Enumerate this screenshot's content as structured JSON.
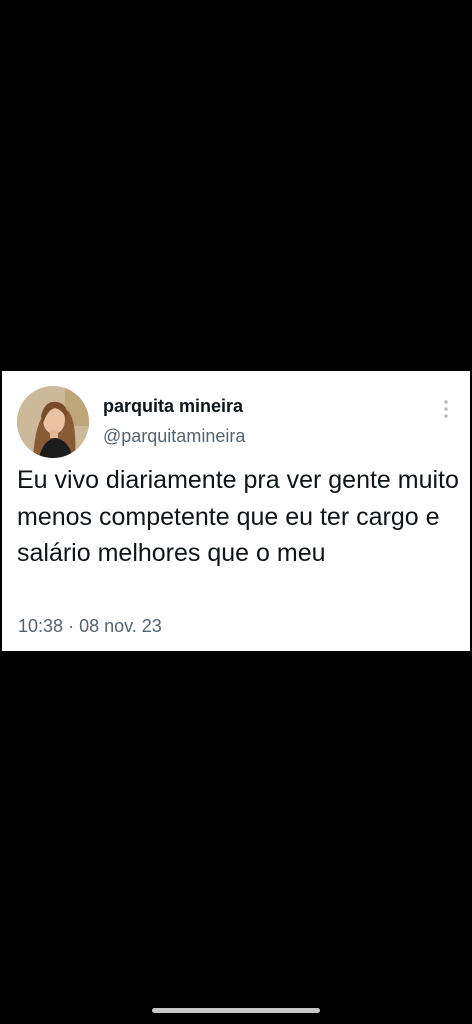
{
  "tweet": {
    "author_name": "parquita mineira",
    "author_handle": "@parquitamineira",
    "text": "Eu vivo diariamente pra ver gente muito menos competente que eu ter cargo e salário melhores que o meu",
    "time": "10:38",
    "separator": "·",
    "date": "08 nov. 23",
    "more_icon": "vertical-ellipsis-icon",
    "avatar_icon": "user-avatar-photo"
  },
  "colors": {
    "background": "#000000",
    "card": "#ffffff",
    "text_primary": "#0f1419",
    "text_secondary": "#536471",
    "home_indicator": "#c8c8c8"
  }
}
